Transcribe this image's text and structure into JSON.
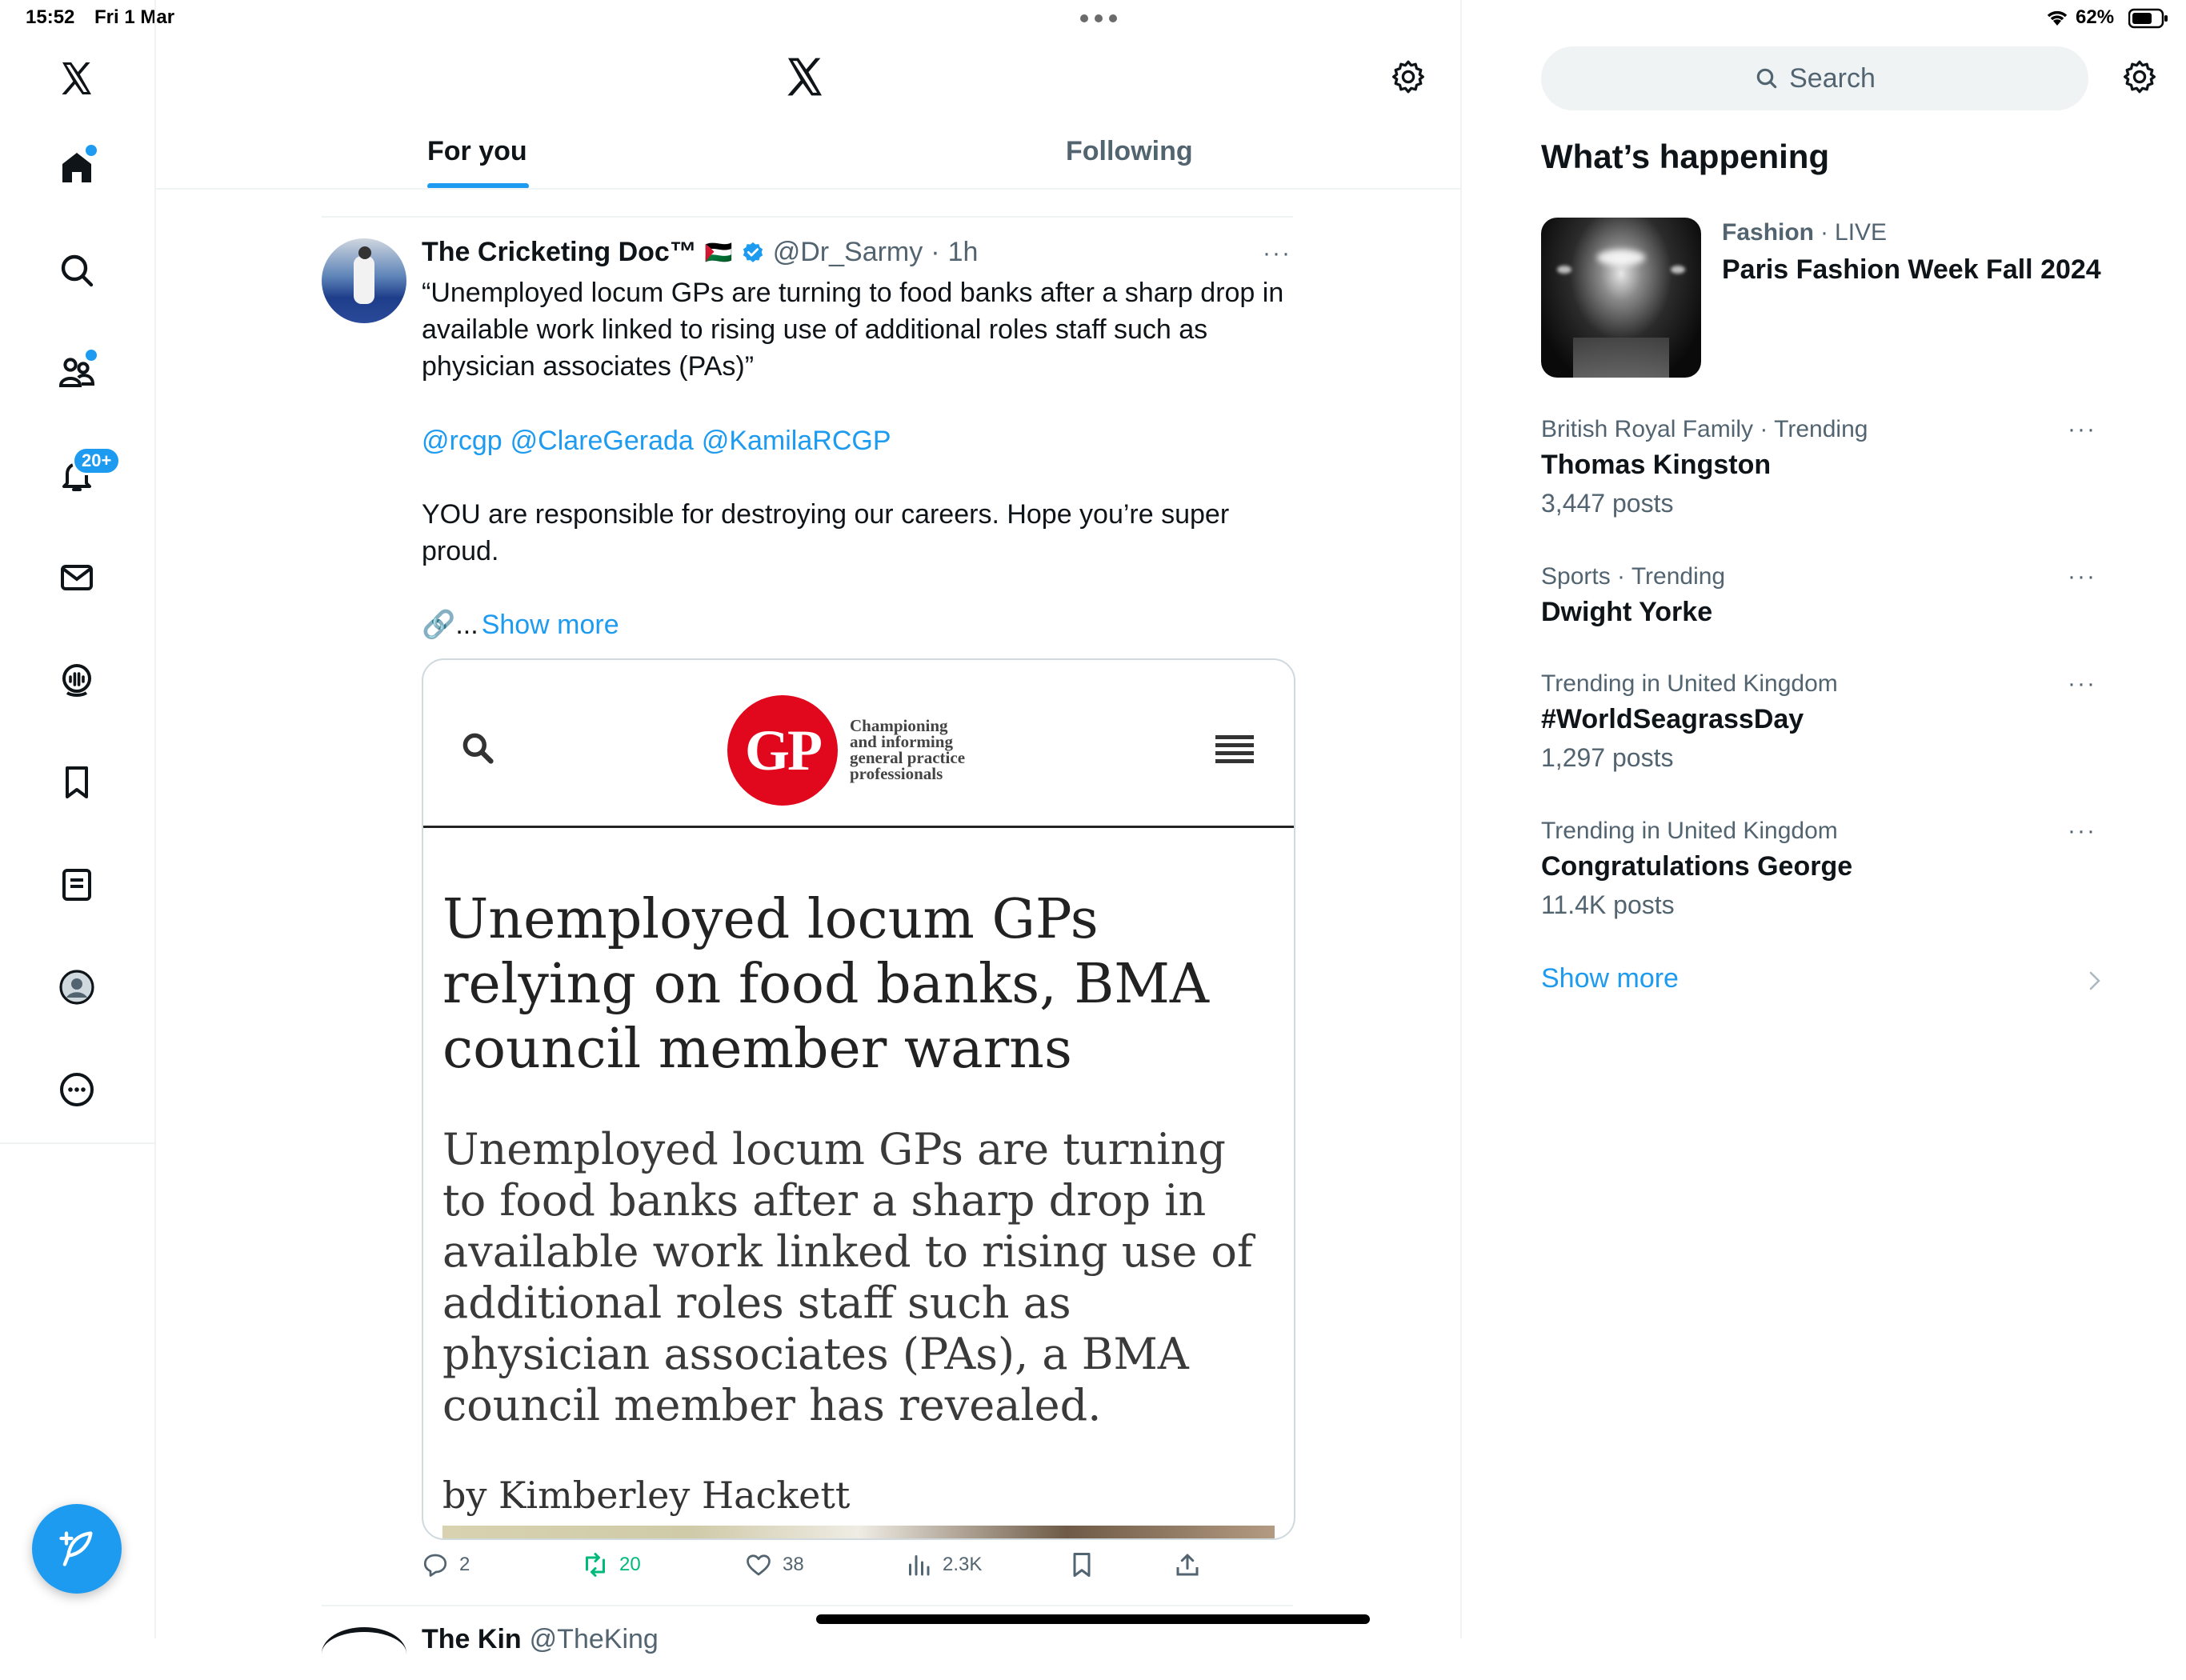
{
  "status_bar": {
    "time": "15:52",
    "date": "Fri 1 Mar",
    "battery": "62%",
    "icons": [
      "wifi-icon",
      "battery-icon"
    ]
  },
  "nav": {
    "items": [
      {
        "name": "logo",
        "icon": "x-logo-icon"
      },
      {
        "name": "home",
        "icon": "home-icon"
      },
      {
        "name": "explore",
        "icon": "search-icon"
      },
      {
        "name": "communities",
        "icon": "communities-icon"
      },
      {
        "name": "notifications",
        "icon": "bell-icon",
        "badge": "20+"
      },
      {
        "name": "messages",
        "icon": "mail-icon"
      },
      {
        "name": "spaces",
        "icon": "spaces-icon"
      },
      {
        "name": "bookmarks",
        "icon": "bookmark-icon"
      },
      {
        "name": "lists",
        "icon": "lists-icon"
      },
      {
        "name": "profile",
        "icon": "avatar-icon"
      },
      {
        "name": "more",
        "icon": "more-circle-icon"
      }
    ],
    "compose_icon": "compose-feather-icon"
  },
  "header": {
    "tabs": [
      {
        "label": "For you",
        "active": true
      },
      {
        "label": "Following",
        "active": false
      }
    ]
  },
  "tweet": {
    "author_name": "The Cricketing Doc™",
    "flag": "🇵🇸",
    "handle": "@Dr_Sarmy",
    "separator": "·",
    "time": "1h",
    "more": "···",
    "text_quote": "“Unemployed locum GPs are turning to food banks after a sharp drop in available work linked to rising use of additional roles staff such as physician associates (PAs)”",
    "mentions": [
      "@rcgp",
      "@ClareGerada",
      "@KamilaRCGP"
    ],
    "text_body": "YOU are responsible for destroying our careers. Hope you’re super proud.",
    "link_prefix": "🔗...",
    "show_more": "Show more",
    "card": {
      "logo_text": "GP",
      "tagline": [
        "Championing",
        "and informing",
        "general practice",
        "professionals"
      ],
      "title": "Unemployed locum GPs relying on food banks, BMA council member warns",
      "description": "Unemployed locum GPs are turning to food banks after a sharp drop in available work linked to rising use of additional roles staff such as physician associates (PAs), a BMA council member has revealed.",
      "byline": "by Kimberley Hackett"
    },
    "actions": {
      "replies": "2",
      "retweets": "20",
      "likes": "38",
      "views": "2.3K"
    }
  },
  "next_tweet_partial": {
    "author_name": "The Kin",
    "handle": "@TheKing"
  },
  "sidebar": {
    "search_placeholder": "Search",
    "title": "What’s happening",
    "featured": {
      "category": "Fashion",
      "separator": "·",
      "status": "LIVE",
      "title": "Paris Fashion Week Fall 2024"
    },
    "trends": [
      {
        "meta": "British Royal Family · Trending",
        "title": "Thomas Kingston",
        "count": "3,447 posts"
      },
      {
        "meta": "Sports · Trending",
        "title": "Dwight Yorke",
        "count": ""
      },
      {
        "meta": "Trending in United Kingdom",
        "title": "#WorldSeagrassDay",
        "count": "1,297 posts"
      },
      {
        "meta": "Trending in United Kingdom",
        "title": "Congratulations George",
        "count": "11.4K posts"
      }
    ],
    "show_more": "Show more",
    "more_dots": "···"
  },
  "colors": {
    "accent": "#1d9bf0",
    "retweet": "#00ba7c",
    "text_primary": "#0f1419",
    "text_secondary": "#536471",
    "gp_red": "#e1081e"
  }
}
